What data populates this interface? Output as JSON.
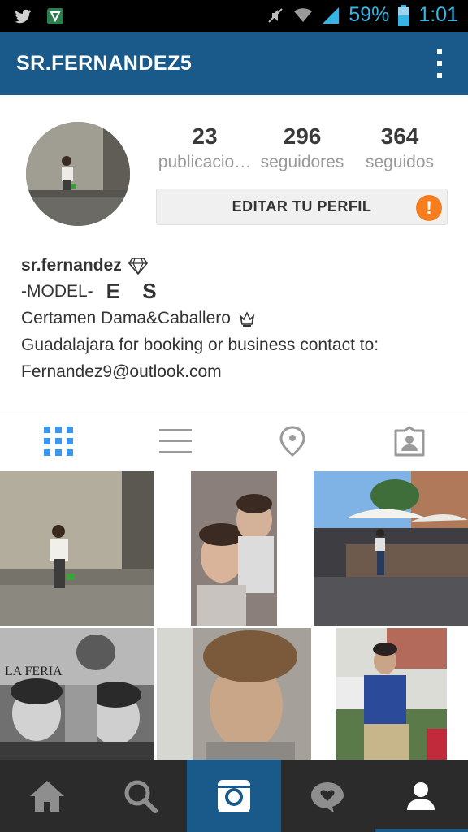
{
  "status_bar": {
    "battery_percent": "59%",
    "time": "1:01",
    "icons": [
      "twitter-icon",
      "shield-app-icon",
      "mute-icon",
      "wifi-icon",
      "signal-icon",
      "battery-icon"
    ]
  },
  "header": {
    "title": "SR.FERNANDEZ5",
    "menu_icon": "more-vert-icon"
  },
  "profile": {
    "stats": [
      {
        "value": "23",
        "label": "publicacio…"
      },
      {
        "value": "296",
        "label": "seguidores"
      },
      {
        "value": "364",
        "label": "seguidos"
      }
    ],
    "edit_button_label": "EDITAR TU PERFIL",
    "alert_badge": "!",
    "username": "sr.fernandez",
    "bio_line1": "-MODEL-",
    "bio_flag_text": "E S",
    "bio_line2": "Certamen Dama&Caballero",
    "bio_line3": "Guadalajara for booking or business contact to:",
    "bio_line4": "Fernandez9@outlook.com"
  },
  "view_tabs": [
    "grid-icon",
    "list-icon",
    "location-icon",
    "tagged-icon"
  ],
  "bottom_nav": [
    "home-icon",
    "search-icon",
    "camera-icon",
    "activity-icon",
    "profile-icon"
  ],
  "colors": {
    "header_bg": "#1a5a8a",
    "accent_blue": "#3897f0",
    "alert_orange": "#f57e20",
    "status_cyan": "#35b5e5",
    "nav_bg": "#2b2b2b"
  }
}
